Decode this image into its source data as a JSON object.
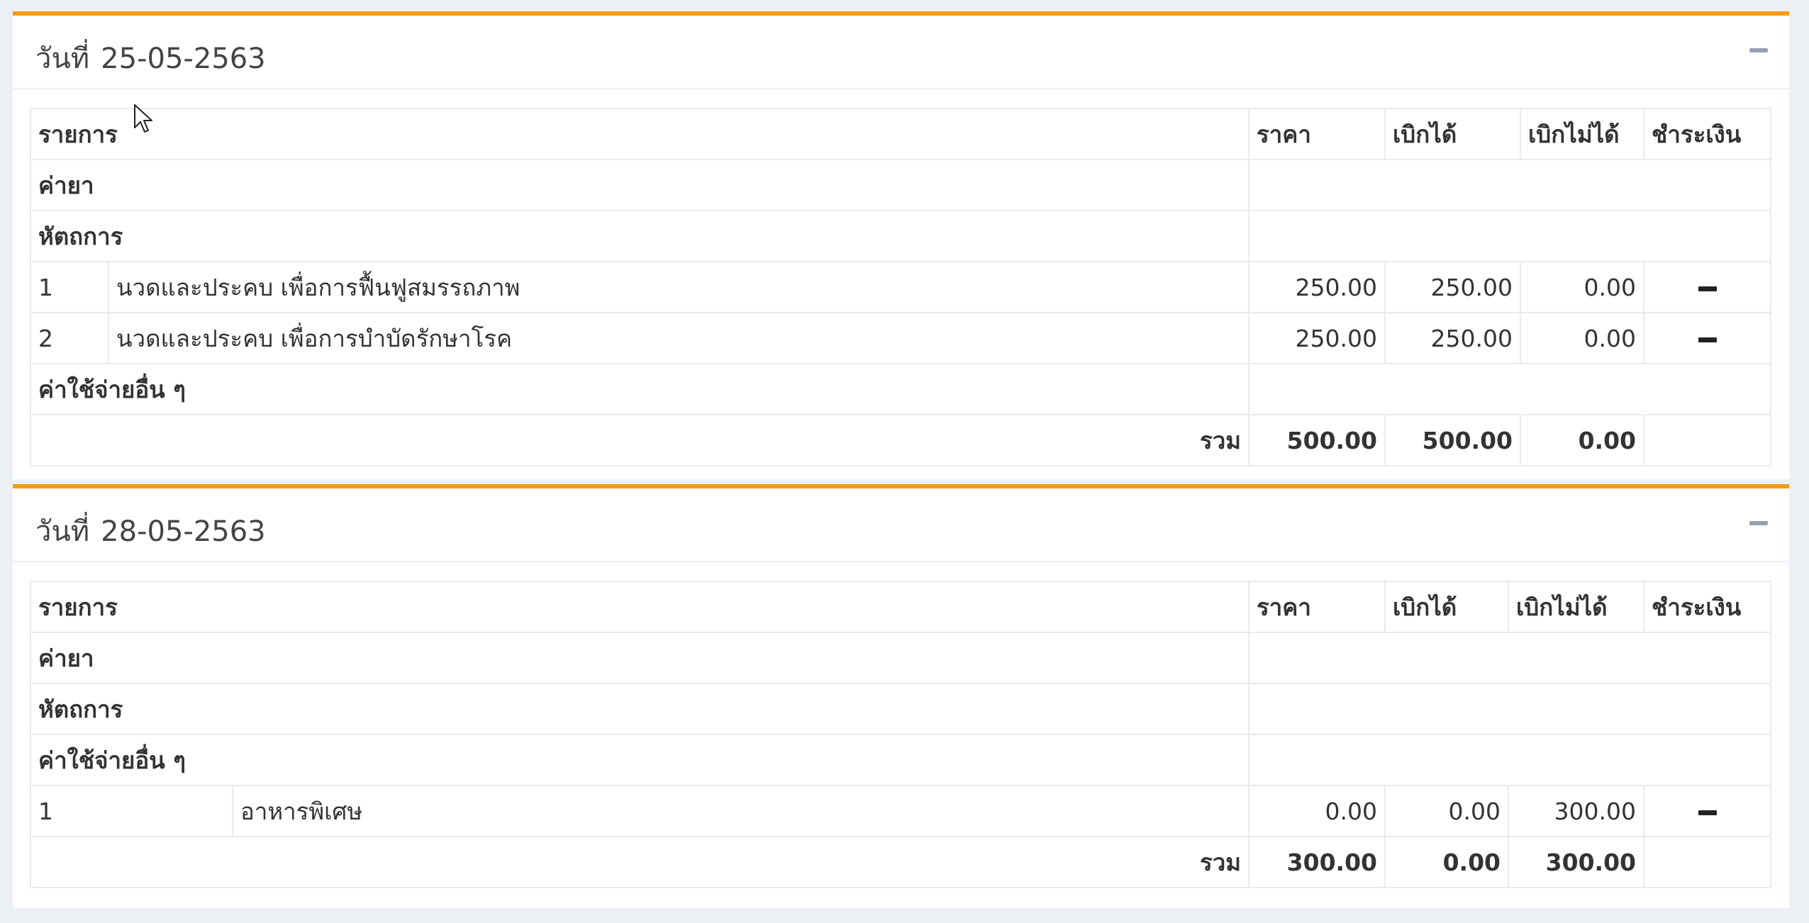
{
  "headers": {
    "item": "รายการ",
    "price": "ราคา",
    "claimable": "เบิกได้",
    "non_claimable": "เบิกไม่ได้",
    "pay": "ชำระเงิน"
  },
  "days": [
    {
      "date_label": "วันที่",
      "date": "25-05-2563",
      "categories": {
        "drugs": "ค่ายา",
        "procedures": "หัตถการ",
        "other": "ค่าใช้จ่ายอื่น ๆ"
      },
      "procedure_rows": [
        {
          "no": "1",
          "name": "นวดและประคบ เพื่อการฟื้นฟูสมรรถภาพ",
          "price": "250.00",
          "claimable": "250.00",
          "non_claimable": "0.00"
        },
        {
          "no": "2",
          "name": "นวดและประคบ เพื่อการบำบัดรักษาโรค",
          "price": "250.00",
          "claimable": "250.00",
          "non_claimable": "0.00"
        }
      ],
      "total": {
        "label": "รวม",
        "price": "500.00",
        "claimable": "500.00",
        "non_claimable": "0.00"
      }
    },
    {
      "date_label": "วันที่",
      "date": "28-05-2563",
      "categories": {
        "drugs": "ค่ายา",
        "procedures": "หัตถการ",
        "other": "ค่าใช้จ่ายอื่น ๆ"
      },
      "other_rows": [
        {
          "no": "1",
          "name": "อาหารพิเศษ",
          "price": "0.00",
          "claimable": "0.00",
          "non_claimable": "300.00"
        }
      ],
      "total": {
        "label": "รวม",
        "price": "300.00",
        "claimable": "0.00",
        "non_claimable": "300.00"
      }
    }
  ],
  "icons": {
    "collapse": "minus-icon",
    "row_action": "minus-icon",
    "cursor": "mouse-pointer-icon"
  },
  "colors": {
    "accent": "#f39c12",
    "background": "#ecf0f5"
  }
}
